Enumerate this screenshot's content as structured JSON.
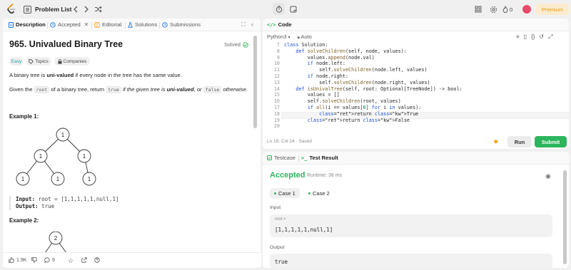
{
  "nav": {
    "problem_list": "Problem List",
    "streak": "0",
    "premium": "Premium"
  },
  "desc_tabs": [
    {
      "label": "Description"
    },
    {
      "label": "Accepted"
    },
    {
      "label": "Editorial"
    },
    {
      "label": "Solutions"
    },
    {
      "label": "Submissions"
    }
  ],
  "problem": {
    "title": "965. Univalued Binary Tree",
    "status": "Solved",
    "difficulty": "Easy",
    "topics": "Topics",
    "companies": "Companies",
    "p1_a": "A binary tree is ",
    "p1_b": "uni-valued",
    "p1_c": " if every node in the tree has the same value.",
    "p2_a": "Given the ",
    "p2_code1": "root",
    "p2_b": " of a binary tree, return ",
    "p2_code2": "true",
    "p2_c": " if the given tree is ",
    "p2_d": "uni-valued",
    "p2_e": ", or ",
    "p2_code3": "false",
    "p2_f": " otherwise."
  },
  "example1": {
    "heading": "Example 1:",
    "input_label": "Input:",
    "input_value": " root = [1,1,1,1,1,null,1]",
    "output_label": "Output:",
    "output_value": " true",
    "tree": [
      "1",
      "1",
      "1",
      "1",
      "1",
      "1"
    ]
  },
  "example2": {
    "heading": "Example 2:",
    "tree_root": "2"
  },
  "footer": {
    "likes": "1.9K",
    "comments": "9"
  },
  "code_panel": {
    "tab": "Code",
    "language": "Python3",
    "mode": "Auto",
    "status": "Ln 18, Col 24  ·  Saved",
    "run": "Run",
    "submit": "Submit"
  },
  "code_lines": [
    {
      "n": "7",
      "t": "class Solution:"
    },
    {
      "n": "8",
      "t": "    def solveChildren(self, node, values):"
    },
    {
      "n": "9",
      "t": "        values.append(node.val)"
    },
    {
      "n": "10",
      "t": "        if node.left:"
    },
    {
      "n": "11",
      "t": "            self.solveChildren(node.left, values)"
    },
    {
      "n": "12",
      "t": "        if node.right:"
    },
    {
      "n": "13",
      "t": "            self.solveChildren(node.right, values)"
    },
    {
      "n": "14",
      "t": "    def isUnivalTree(self, root: Optional[TreeNode]) -> bool:"
    },
    {
      "n": "15",
      "t": "        values = []"
    },
    {
      "n": "16",
      "t": "        self.solveChildren(root, values)"
    },
    {
      "n": "17",
      "t": "        if all(i == values[0] for i in values):"
    },
    {
      "n": "18",
      "t": "            return True"
    },
    {
      "n": "19",
      "t": "        return False"
    },
    {
      "n": "20",
      "t": ""
    }
  ],
  "result_tabs": [
    {
      "label": "Testcase"
    },
    {
      "label": "Test Result"
    }
  ],
  "result": {
    "verdict": "Accepted",
    "runtime": "Runtime: 38 ms",
    "case1": "Case 1",
    "case2": "Case 2",
    "input_label": "Input",
    "root_label": "root =",
    "root_value": "[1,1,1,1,1,null,1]",
    "output_label": "Output",
    "output_value": "true"
  }
}
